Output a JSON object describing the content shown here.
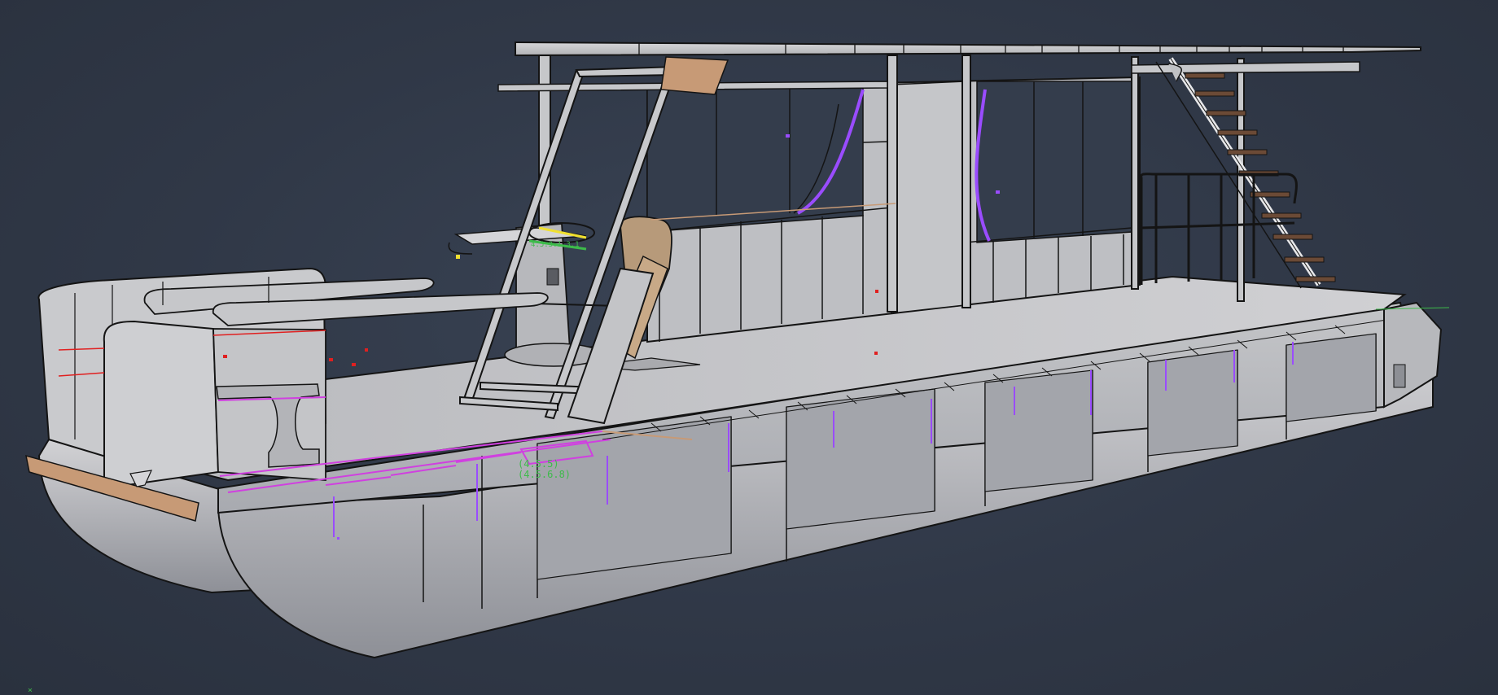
{
  "viewport": {
    "background": "#2f3746",
    "mode": "shaded-with-edges"
  },
  "model": {
    "subject": "pontoon houseboat hull and deck structure",
    "colors": {
      "surface": "#c9c9cc",
      "surface_dark": "#9a9ca3",
      "edge": "#141414",
      "trim_wood": "#c79a76",
      "highlight_magenta": "#d040e0",
      "highlight_purple": "#9a4cff",
      "highlight_red": "#e02020",
      "dim_green": "#3dbb4a",
      "marker_yellow": "#f0e030"
    }
  },
  "annotations": {
    "dimension_line1": "(4.5.5)",
    "dimension_line2": "(4.5.6.8)",
    "helm_tag": "4.5.3.1.3.1",
    "axis_marker": "×"
  }
}
